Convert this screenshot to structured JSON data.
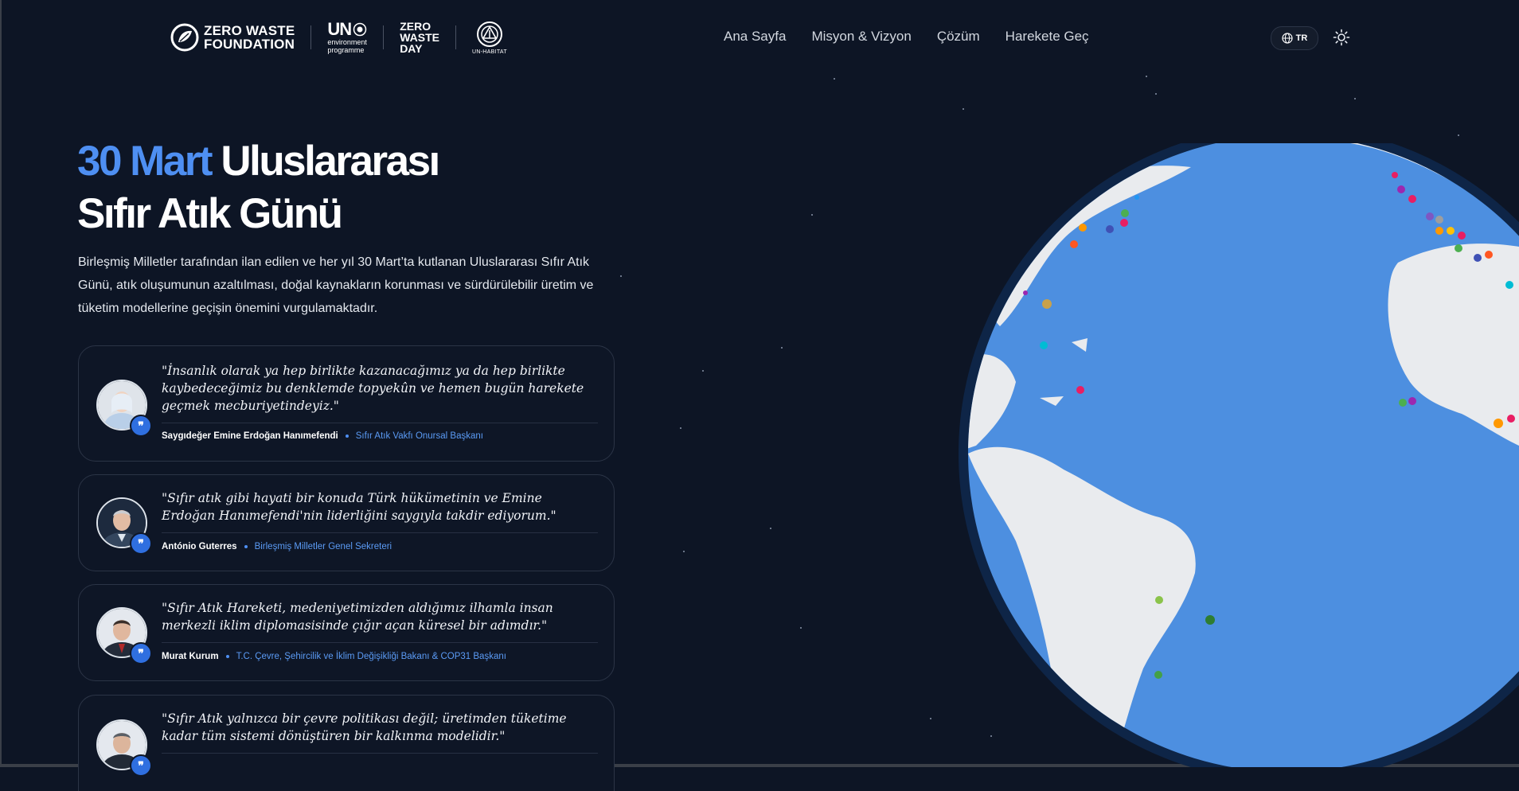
{
  "brand": {
    "zwf_line1": "ZERO WASTE",
    "zwf_line2": "FOUNDATION",
    "un_main": "UN",
    "un_line1": "environment",
    "un_line2": "programme",
    "zwd_line1": "ZERO",
    "zwd_line2": "WASTE",
    "zwd_line3": "DAY",
    "unh_label": "UN-HABITAT"
  },
  "nav": {
    "items": [
      {
        "label": "Ana Sayfa"
      },
      {
        "label": "Misyon & Vizyon"
      },
      {
        "label": "Çözüm"
      },
      {
        "label": "Harekete Geç"
      }
    ]
  },
  "language": {
    "label": "TR"
  },
  "hero": {
    "title_accent": "30 Mart",
    "title_rest": "Uluslararası",
    "title_line2": "Sıfır Atık Günü",
    "description": "Birleşmiş Milletler tarafından ilan edilen ve her yıl 30 Mart’ta kutlanan Uluslararası Sıfır Atık Günü, atık oluşumunun azaltılması, doğal kaynakların korunması ve sürdürülebilir üretim ve tüketim modellerine geçişin önemini vurgulamaktadır."
  },
  "quotes": [
    {
      "text": "\"İnsanlık olarak ya hep birlikte kazanacağımız ya da hep birlikte kaybedeceğimiz bu denklemde topyekûn ve hemen bugün harekete geçmek mecburiyetindeyiz.\"",
      "name": "Saygıdeğer Emine Erdoğan Hanımefendi",
      "role": "Sıfır Atık Vakfı Onursal Başkanı"
    },
    {
      "text": "\"Sıfır atık gibi hayati bir konuda Türk hükümetinin ve Emine Erdoğan Hanımefendi'nin liderliğini saygıyla takdir ediyorum.\"",
      "name": "António Guterres",
      "role": "Birleşmiş Milletler Genel Sekreteri"
    },
    {
      "text": "\"Sıfır Atık Hareketi, medeniyetimizden aldığımız ilhamla insan merkezli iklim diplomasisinde çığır açan küresel bir adımdır.\"",
      "name": "Murat Kurum",
      "role": "T.C. Çevre, Şehircilik ve İklim Değişikliği Bakanı & COP31 Başkanı"
    },
    {
      "text": "\"Sıfır Atık yalnızca bir çevre politikası değil; üretimden tüketime kadar tüm sistemi dönüştüren bir kalkınma modelidir.\"",
      "name": "",
      "role": ""
    }
  ],
  "colors": {
    "background": "#0d1525",
    "accent": "#4e8ff2",
    "ocean": "#4d8fe0",
    "land": "#e9ebee"
  },
  "icons": {
    "language": "globe-icon",
    "theme": "sun-icon",
    "quote_badge": "quote-icon"
  }
}
